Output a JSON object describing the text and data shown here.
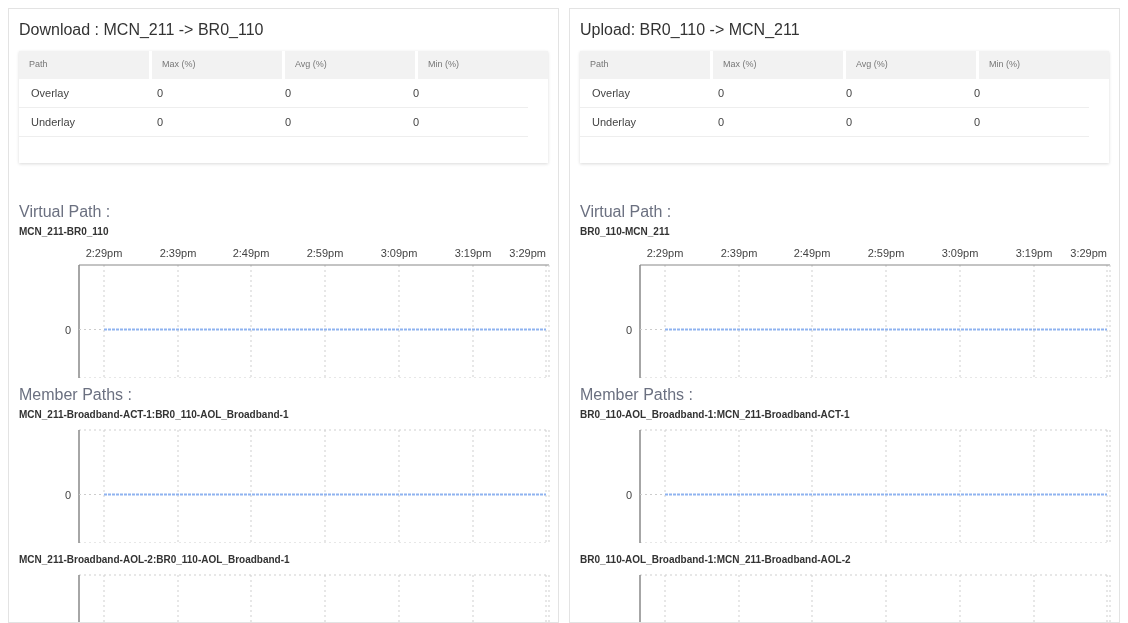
{
  "panels": [
    {
      "title": "Download : MCN_211 -> BR0_110",
      "table": {
        "columns": [
          "Path",
          "Max (%)",
          "Avg (%)",
          "Min (%)"
        ],
        "rows": [
          [
            "Overlay",
            "0",
            "0",
            "0"
          ],
          [
            "Underlay",
            "0",
            "0",
            "0"
          ]
        ]
      },
      "virtual_path": {
        "heading": "Virtual Path :",
        "charts": [
          {
            "name": "MCN_211-BR0_110",
            "x_tick_labels": [
              "2:29pm",
              "2:39pm",
              "2:49pm",
              "2:59pm",
              "3:09pm",
              "3:19pm",
              "3:29pm"
            ],
            "y_tick_label": "0"
          }
        ]
      },
      "member_paths": {
        "heading": "Member Paths :",
        "charts": [
          {
            "name": "MCN_211-Broadband-ACT-1:BR0_110-AOL_Broadband-1",
            "y_tick_label": "0"
          },
          {
            "name": "MCN_211-Broadband-AOL-2:BR0_110-AOL_Broadband-1"
          }
        ]
      }
    },
    {
      "title": "Upload: BR0_110 -> MCN_211",
      "table": {
        "columns": [
          "Path",
          "Max (%)",
          "Avg (%)",
          "Min (%)"
        ],
        "rows": [
          [
            "Overlay",
            "0",
            "0",
            "0"
          ],
          [
            "Underlay",
            "0",
            "0",
            "0"
          ]
        ]
      },
      "virtual_path": {
        "heading": "Virtual Path :",
        "charts": [
          {
            "name": "BR0_110-MCN_211",
            "x_tick_labels": [
              "2:29pm",
              "2:39pm",
              "2:49pm",
              "2:59pm",
              "3:09pm",
              "3:19pm",
              "3:29pm"
            ],
            "y_tick_label": "0"
          }
        ]
      },
      "member_paths": {
        "heading": "Member Paths :",
        "charts": [
          {
            "name": "BR0_110-AOL_Broadband-1:MCN_211-Broadband-ACT-1",
            "y_tick_label": "0"
          },
          {
            "name": "BR0_110-AOL_Broadband-1:MCN_211-Broadband-AOL-2"
          }
        ]
      }
    }
  ]
}
